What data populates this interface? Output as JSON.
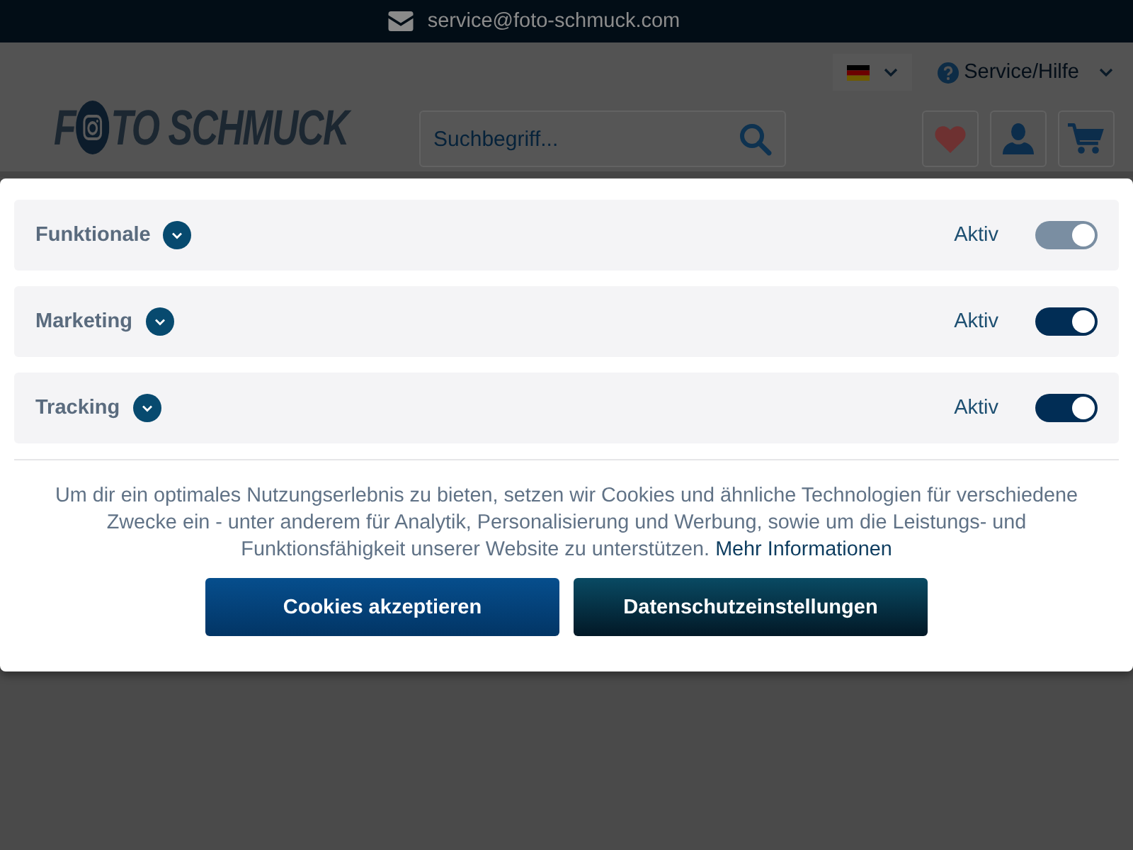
{
  "top_bar": {
    "email": "service@foto-schmuck.com"
  },
  "header": {
    "service_menu": "Service/Hilfe",
    "logo": {
      "before_icon": "F",
      "after_icon": "TO SCHMUCK"
    },
    "search": {
      "placeholder": "Suchbegriff..."
    }
  },
  "cookie_modal": {
    "categories": [
      {
        "name": "Funktionale",
        "expanded": false,
        "status": "Aktiv",
        "on": true,
        "disabled": true
      },
      {
        "name": "Marketing",
        "expanded": false,
        "status": "Aktiv",
        "on": true,
        "disabled": false
      },
      {
        "name": "Tracking",
        "expanded": false,
        "status": "Aktiv",
        "on": true,
        "disabled": false
      }
    ],
    "text": "Um dir ein optimales Nutzungserlebnis zu bieten, setzen wir Cookies und ähnliche Technologien für verschiedene Zwecke ein - unter anderem für Analytik, Personalisierung und Werbung, sowie um die Leistungs- und Funktionsfähigkeit unserer Website zu unterstützen.",
    "link": "Mehr Informationen",
    "buttons": [
      {
        "label": "Cookies akzeptieren",
        "kind": "primary"
      },
      {
        "label": "Datenschutzeinstellungen",
        "kind": "secondary"
      }
    ]
  }
}
